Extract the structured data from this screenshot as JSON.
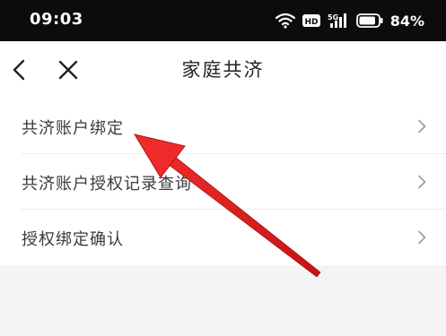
{
  "status_bar": {
    "time": "09:03",
    "hd_badge": "HD",
    "network_label": "5G",
    "battery_text": "84%",
    "icons": [
      "wifi-icon",
      "hd-icon",
      "signal-5g-icon",
      "battery-icon"
    ]
  },
  "nav": {
    "title": "家庭共济",
    "back_icon": "chevron-left-icon",
    "close_icon": "close-icon"
  },
  "menu": {
    "items": [
      {
        "label": "共济账户绑定"
      },
      {
        "label": "共济账户授权记录查询"
      },
      {
        "label": "授权绑定确认"
      }
    ]
  },
  "annotation": {
    "color": "#e02020"
  }
}
